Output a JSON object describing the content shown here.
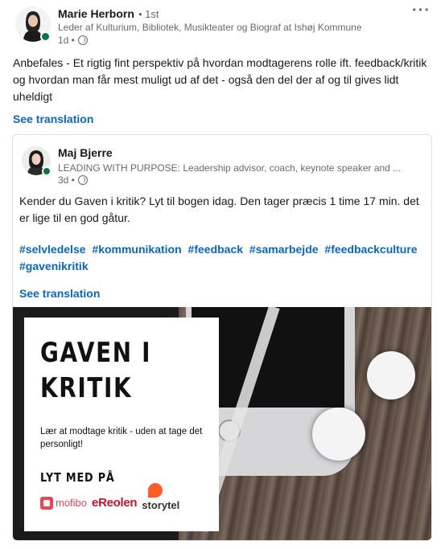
{
  "post": {
    "author": {
      "name": "Marie Herborn",
      "degree": "• 1st",
      "headline": "Leder af Kulturium, Bibliotek, Musikteater og Biograf at Ishøj Kommune",
      "time": "1d •"
    },
    "more_label": "···",
    "commentary": "Anbefales - Et rigtig fint perspektiv på hvordan modtagerens rolle ift. feedback/kritik og hvordan man får mest muligt ud af det - også den del der af og til gives lidt uheldigt",
    "see_translation": "See translation"
  },
  "shared_post": {
    "author": {
      "name": "Maj Bjerre",
      "headline": "LEADING WITH PURPOSE: Leadership advisor, coach, keynote speaker and ...",
      "time": "3d •"
    },
    "text": "Kender du Gaven i kritik? Lyt til bogen idag. Den tager præcis 1 time 17 min. det er lige til en god gåtur.",
    "hashtags": [
      "#selvledelse",
      "#kommunikation",
      "#feedback",
      "#samarbejde",
      "#feedbackculture",
      "#gavenikritik"
    ],
    "see_translation": "See translation",
    "image": {
      "title_line1": "GAVEN I",
      "title_line2": "KRITIK",
      "subtitle": "Lær at modtage kritik - uden at tage det personligt!",
      "listen_on": "LYT MED PÅ",
      "logos": [
        "mofibo",
        "eReolen",
        "storytel"
      ]
    }
  },
  "colors": {
    "link": "#0a66c2",
    "online": "#057642",
    "ereolen": "#c0132c",
    "mofibo": "#e84855",
    "storytel": "#ff5c28"
  }
}
